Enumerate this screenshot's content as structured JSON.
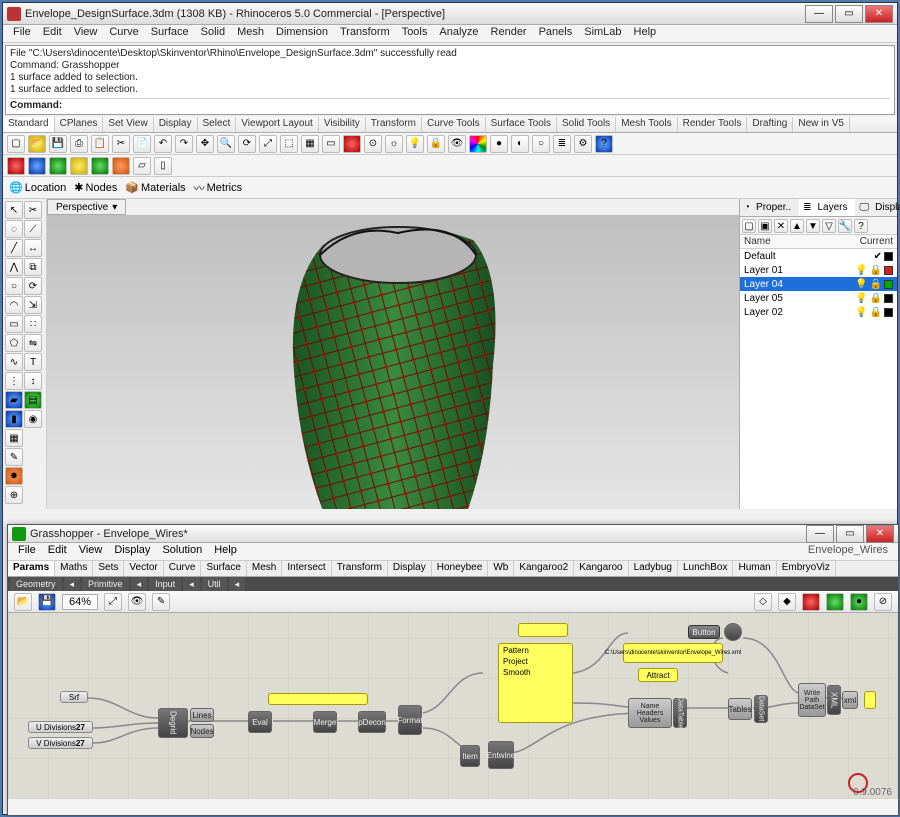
{
  "rhino": {
    "title": "Envelope_DesignSurface.3dm (1308 KB) - Rhinoceros 5.0 Commercial - [Perspective]",
    "menu": [
      "File",
      "Edit",
      "View",
      "Curve",
      "Surface",
      "Solid",
      "Mesh",
      "Dimension",
      "Transform",
      "Tools",
      "Analyze",
      "Render",
      "Panels",
      "SimLab",
      "Help"
    ],
    "cmd_log": [
      "File \"C:\\Users\\dinocente\\Desktop\\Skinventor\\Rhino\\Envelope_DesignSurface.3dm\" successfully read",
      "Command: Grasshopper",
      "1 surface added to selection.",
      "1 surface added to selection."
    ],
    "cmd_prompt": "Command:",
    "tool_tabs": [
      "Standard",
      "CPlanes",
      "Set View",
      "Display",
      "Select",
      "Viewport Layout",
      "Visibility",
      "Transform",
      "Curve Tools",
      "Surface Tools",
      "Solid Tools",
      "Mesh Tools",
      "Render Tools",
      "Drafting",
      "New in V5"
    ],
    "skin_bar": {
      "location": "Location",
      "nodes": "Nodes",
      "materials": "Materials",
      "metrics": "Metrics"
    },
    "viewport_tab": "Perspective",
    "panel_tabs": {
      "properties": "Proper..",
      "layers": "Layers",
      "display": "Display"
    },
    "layer_header": {
      "name": "Name",
      "current": "Current"
    },
    "layers": [
      {
        "name": "Default",
        "current": true,
        "color": "#000"
      },
      {
        "name": "Layer 01",
        "color": "#c22"
      },
      {
        "name": "Layer 04",
        "color": "#0a0",
        "selected": true
      },
      {
        "name": "Layer 05",
        "color": "#000"
      },
      {
        "name": "Layer 02",
        "color": "#000"
      }
    ]
  },
  "gh": {
    "title": "Grasshopper - Envelope_Wires*",
    "menu": [
      "File",
      "Edit",
      "View",
      "Display",
      "Solution",
      "Help"
    ],
    "doc": "Envelope_Wires",
    "tabs": [
      "Params",
      "Maths",
      "Sets",
      "Vector",
      "Curve",
      "Surface",
      "Mesh",
      "Intersect",
      "Transform",
      "Display",
      "Honeybee",
      "Wb",
      "Kangaroo2",
      "Kangaroo",
      "Ladybug",
      "LunchBox",
      "Human",
      "EmbryoViz"
    ],
    "subtabs": [
      "Geometry",
      "Primitive",
      "Input",
      "Util"
    ],
    "zoom": "64%",
    "version": "0.9.0076",
    "nodes": {
      "srf": "Srf",
      "udiv": "U Divisions",
      "udiv_val": "27",
      "vdiv": "V Divisions",
      "vdiv_val": "27",
      "degrid": "Degrid",
      "lines": "Lines",
      "nodes": "Nodes",
      "eval": "Eval",
      "merge": "Merge",
      "pdecon": "pDecon",
      "format": "Format",
      "pattern": "Pattern",
      "project": "Project",
      "smooth": "Smooth",
      "attr": "Attract",
      "item": "Item",
      "entwine": "Entwine",
      "name": "Name",
      "headers": "Headers",
      "values": "Values",
      "datatable": "DataTable",
      "tables": "Tables",
      "dataset": "DataSet",
      "button": "Button",
      "write": "Write",
      "path": "Path",
      "xml": "XML",
      "panel_path": "C:\\Users\\dinocente\\skinventor\\Envelope_Wires.xml"
    }
  }
}
